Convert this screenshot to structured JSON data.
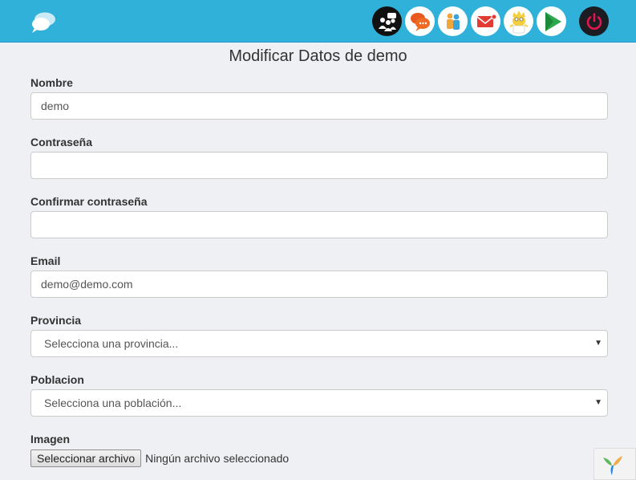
{
  "header": {
    "logo_icon": "speech-bubbles-logo-icon",
    "nav_icons": [
      "group-chat-icon",
      "orange-chat-icon",
      "friends-icon",
      "mail-icon",
      "character-icon",
      "play-icon",
      "power-icon"
    ],
    "colors": {
      "bar": "#2fb1d9",
      "power": "#e0174f"
    }
  },
  "page": {
    "title": "Modificar Datos de demo"
  },
  "form": {
    "nombre": {
      "label": "Nombre",
      "value": "demo"
    },
    "password": {
      "label": "Contraseña",
      "value": ""
    },
    "confirm_password": {
      "label": "Confirmar contraseña",
      "value": ""
    },
    "email": {
      "label": "Email",
      "value": "demo@demo.com"
    },
    "provincia": {
      "label": "Provincia",
      "selected": "Selecciona una provincia..."
    },
    "poblacion": {
      "label": "Poblacion",
      "selected": "Selecciona una población..."
    },
    "imagen": {
      "label": "Imagen",
      "button": "Seleccionar archivo",
      "status": "Ningún archivo seleccionado"
    }
  },
  "footer": {
    "badge_icon": "yii-logo-icon"
  }
}
